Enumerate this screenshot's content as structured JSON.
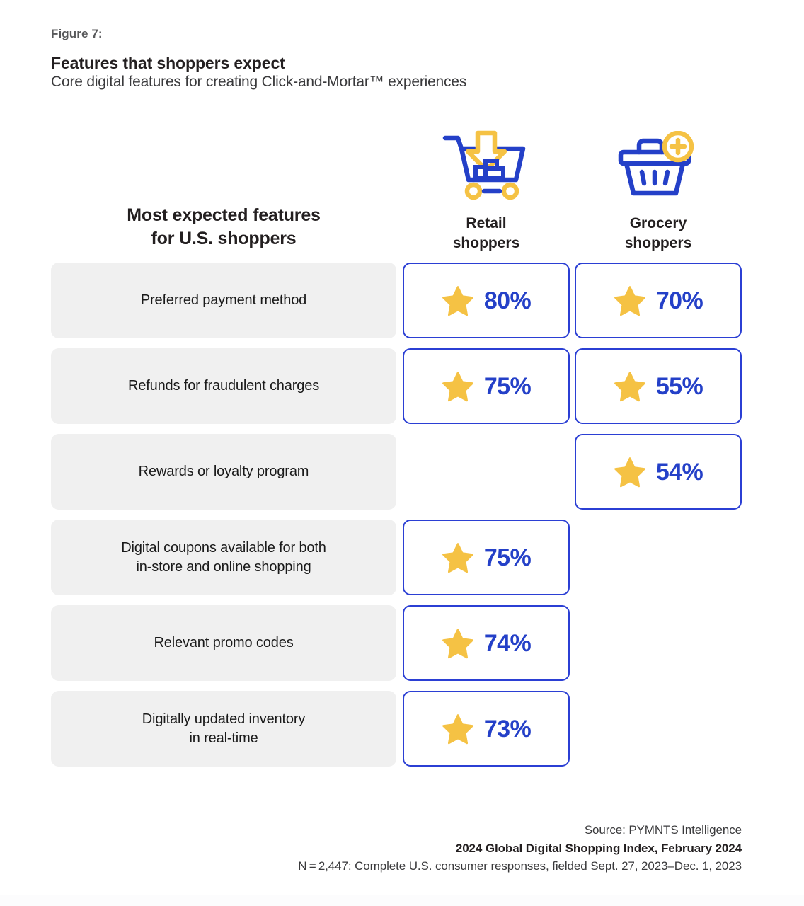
{
  "header": {
    "figure_label": "Figure 7:",
    "title": "Features that shoppers expect",
    "subtitle": "Core digital features for creating Click-and-Mortar™ experiences"
  },
  "table": {
    "row_header_title_line1": "Most expected features",
    "row_header_title_line2": "for U.S. shoppers",
    "columns": [
      {
        "key": "retail",
        "icon": "shopping-cart-download-icon",
        "label_line1": "Retail",
        "label_line2": "shoppers"
      },
      {
        "key": "grocery",
        "icon": "shopping-basket-plus-icon",
        "label_line1": "Grocery",
        "label_line2": "shoppers"
      }
    ],
    "rows": [
      {
        "label_line1": "Preferred payment method",
        "label_line2": "",
        "retail": "80%",
        "grocery": "70%"
      },
      {
        "label_line1": "Refunds for fraudulent charges",
        "label_line2": "",
        "retail": "75%",
        "grocery": "55%"
      },
      {
        "label_line1": "Rewards or loyalty program",
        "label_line2": "",
        "retail": "",
        "grocery": "54%"
      },
      {
        "label_line1": "Digital coupons available for both",
        "label_line2": "in-store and online shopping",
        "retail": "75%",
        "grocery": ""
      },
      {
        "label_line1": "Relevant promo codes",
        "label_line2": "",
        "retail": "74%",
        "grocery": ""
      },
      {
        "label_line1": "Digitally updated inventory",
        "label_line2": "in real-time",
        "retail": "73%",
        "grocery": ""
      }
    ]
  },
  "footer": {
    "source": "Source: PYMNTS Intelligence",
    "report": "2024 Global Digital Shopping Index, February 2024",
    "sample": "N = 2,447: Complete U.S. consumer responses, fielded Sept. 27, 2023–Dec. 1, 2023"
  },
  "colors": {
    "blue": "#2440c8",
    "border_blue": "#2b3fd4",
    "yellow": "#f5c244",
    "row_bg": "#f0f0f0",
    "text": "#231f20",
    "muted": "#58595b"
  },
  "chart_data": {
    "type": "table",
    "title": "Features that shoppers expect",
    "subtitle": "Core digital features for creating Click-and-Mortar™ experiences",
    "categories": [
      "Preferred payment method",
      "Refunds for fraudulent charges",
      "Rewards or loyalty program",
      "Digital coupons available for both in-store and online shopping",
      "Relevant promo codes",
      "Digitally updated inventory in real-time"
    ],
    "series": [
      {
        "name": "Retail shoppers",
        "values": [
          80,
          75,
          null,
          75,
          74,
          73
        ]
      },
      {
        "name": "Grocery shoppers",
        "values": [
          70,
          55,
          54,
          null,
          null,
          null
        ]
      }
    ],
    "unit": "percent",
    "ylim": [
      0,
      100
    ],
    "grid": false,
    "legend": "top"
  }
}
